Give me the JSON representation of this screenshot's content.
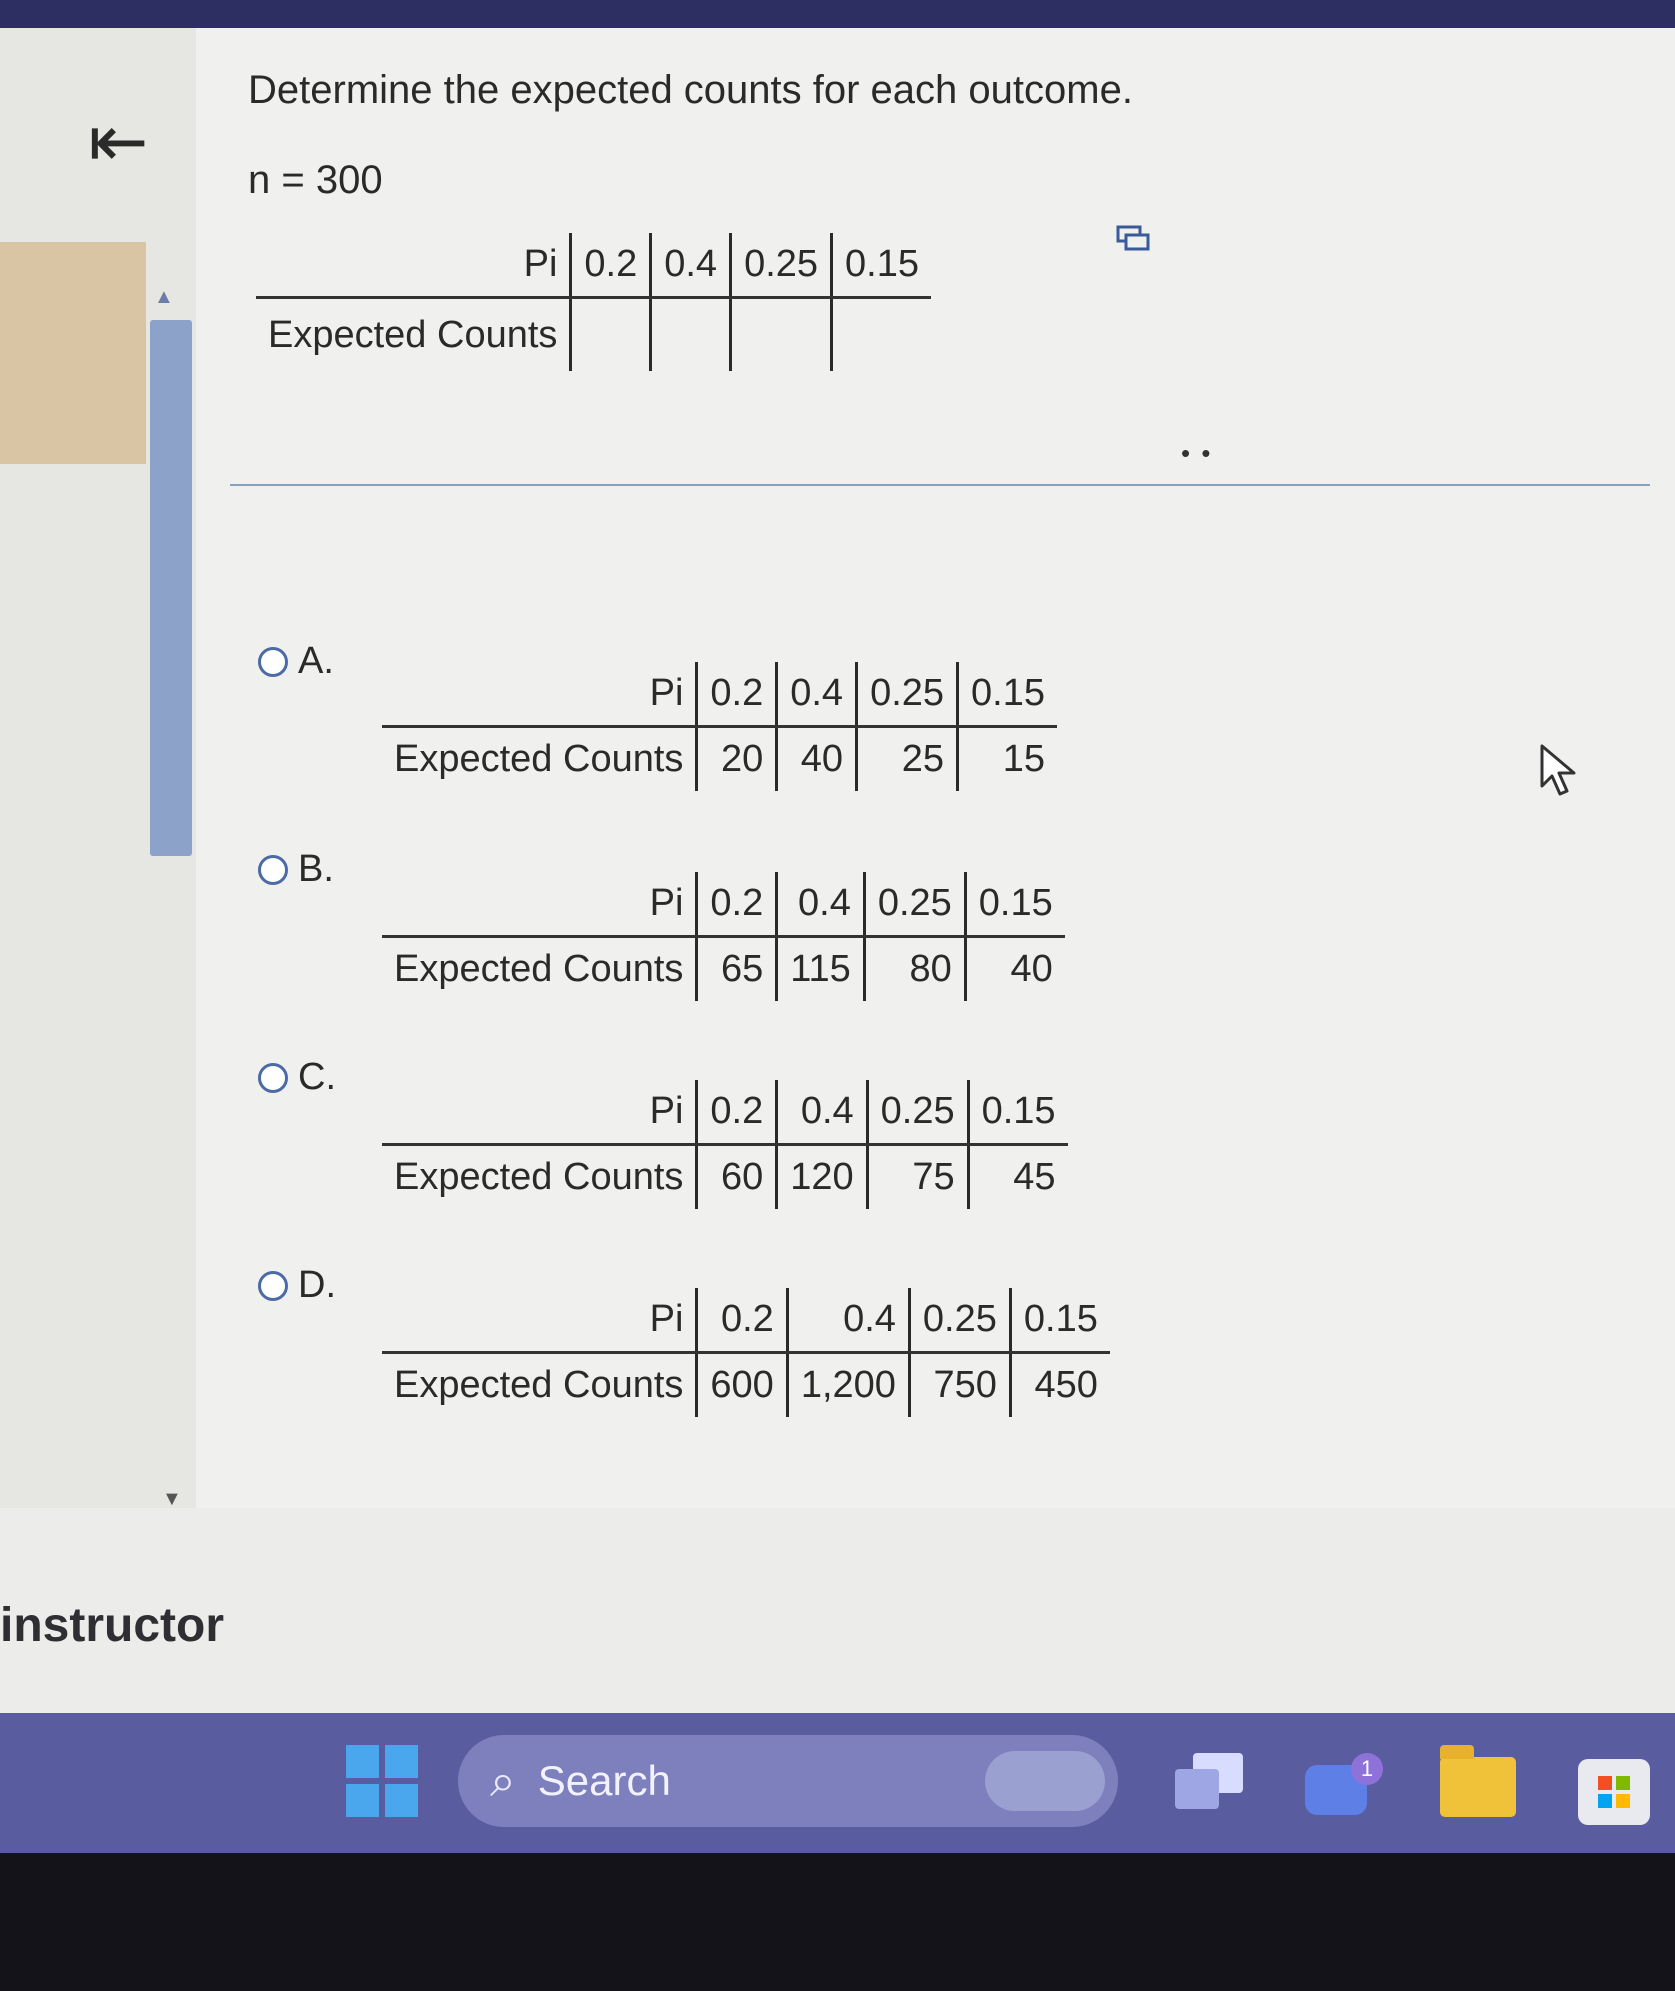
{
  "question": {
    "prompt": "Determine the expected counts for each outcome.",
    "n_text": "n = 300",
    "row_label_p": "Pi",
    "row_label_counts": "Expected Counts",
    "probabilities": [
      "0.2",
      "0.4",
      "0.25",
      "0.15"
    ]
  },
  "options": [
    {
      "letter": "A.",
      "counts": [
        "20",
        "40",
        "25",
        "15"
      ]
    },
    {
      "letter": "B.",
      "counts": [
        "65",
        "115",
        "80",
        "40"
      ]
    },
    {
      "letter": "C.",
      "counts": [
        "60",
        "120",
        "75",
        "45"
      ]
    },
    {
      "letter": "D.",
      "counts": [
        "600",
        "1,200",
        "750",
        "450"
      ]
    }
  ],
  "sidebar": {
    "collapse_glyph": "⇤",
    "footer_text": "instructor"
  },
  "taskbar": {
    "search_label": "Search",
    "chat_badge": "1"
  }
}
